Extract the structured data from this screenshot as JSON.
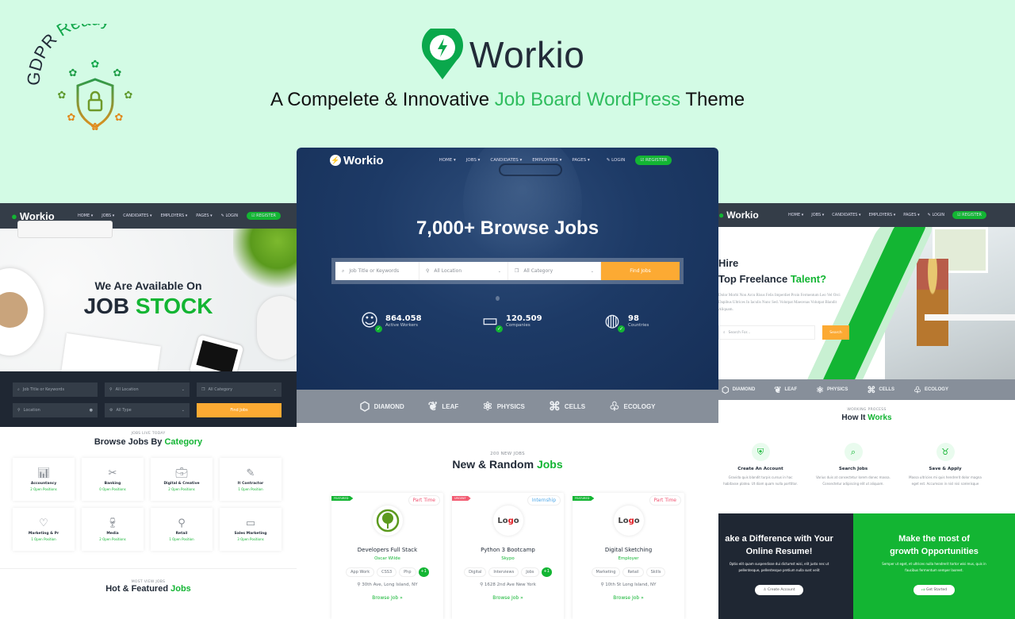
{
  "banner": {
    "gdpr_text_1": "GDPR",
    "gdpr_text_2": "Ready",
    "brand_name": "Workio",
    "tagline_pre": "A Compelete & Innovative ",
    "tagline_highlight": "Job Board WordPress",
    "tagline_post": " Theme"
  },
  "colors": {
    "brand_green": "#13b533",
    "accent_orange": "#fcaa33",
    "dark_navy": "#222b38",
    "banner_bg": "#d3fbe5"
  },
  "nav": {
    "logo": "Workio",
    "items": [
      "HOME",
      "JOBS",
      "CANDIDATES",
      "EMPLOYERS",
      "PAGES"
    ],
    "login": "LOGIN",
    "register": "REGISTER"
  },
  "left_screen": {
    "hero_subtitle": "We Are Available On",
    "hero_title_1": "JOB",
    "hero_title_2": "STOCK",
    "search": {
      "keywords_placeholder": "Job Title or Keywords",
      "location_select": "All Location",
      "category_select": "All Category",
      "location_placeholder": "Location",
      "type_select": "All Type",
      "button": "Find Jobs"
    },
    "categories_kicker": "JOBS LIVE TODAY",
    "categories_title_1": "Browse Jobs By",
    "categories_title_2": "Category",
    "categories": [
      {
        "name": "Accountancy",
        "count": "2 Open Positions",
        "icon": "chart-icon"
      },
      {
        "name": "Banking",
        "count": "0 Open Positions",
        "icon": "tools-icon"
      },
      {
        "name": "Digital & Creative",
        "count": "2 Open Positions",
        "icon": "briefcase-icon"
      },
      {
        "name": "It Contractor",
        "count": "1 Open Position",
        "icon": "edit-icon"
      },
      {
        "name": "Marketing & Pr",
        "count": "1 Open Position",
        "icon": "heart-icon"
      },
      {
        "name": "Media",
        "count": "2 Open Positions",
        "icon": "glass-icon"
      },
      {
        "name": "Retail",
        "count": "1 Open Position",
        "icon": "map-icon"
      },
      {
        "name": "Sales Marketing",
        "count": "3 Open Positions",
        "icon": "monitor-icon"
      }
    ],
    "hot_kicker": "MOST VIEW JOBS",
    "hot_title_1": "Hot & Featured",
    "hot_title_2": "Jobs"
  },
  "center_screen": {
    "hero_title": "7,000+ Browse Jobs",
    "search": {
      "keywords_placeholder": "Job Title or Keywords",
      "location_select": "All Location",
      "category_select": "All Category",
      "button": "Find Jobs"
    },
    "stats": [
      {
        "value": "864.058",
        "label": "Active Workers",
        "icon": "user-icon"
      },
      {
        "value": "120.509",
        "label": "Companies",
        "icon": "monitor-icon"
      },
      {
        "value": "98",
        "label": "Countries",
        "icon": "globe-icon"
      }
    ],
    "partners": [
      "DIAMOND",
      "LEAF",
      "PHYSICS",
      "CELLS",
      "ECOLOGY"
    ],
    "jobs_kicker": "200 NEW JOBS",
    "jobs_title_1": "New & Random",
    "jobs_title_2": "Jobs",
    "jobs": [
      {
        "badge": "FEATURED",
        "type": "Part Time",
        "title": "Developers Full Stack",
        "company": "Oscar Wilde",
        "tags": [
          "App Work",
          "CSS3",
          "Php"
        ],
        "more": "+1",
        "location": "30th Ave, Long Island, NY",
        "link": "Browse Job »"
      },
      {
        "badge": "URGENT",
        "type": "Internship",
        "title": "Python 3 Bootcamp",
        "company": "Skypo",
        "tags": [
          "Digital",
          "Interviews",
          "Jobs"
        ],
        "more": "+1",
        "location": "1628 2nd Ave New York",
        "link": "Browse Job »"
      },
      {
        "badge": "FEATURED",
        "type": "Part Time",
        "title": "Digital Sketching",
        "company": "Employer",
        "tags": [
          "Marketing",
          "Retail",
          "Skills"
        ],
        "more": "",
        "location": "10th St Long Island, NY",
        "link": "Browse Job »"
      }
    ]
  },
  "right_screen": {
    "hero_line_1": "Hire",
    "hero_line_2a": "Top Freelance",
    "hero_line_2b": "Talent?",
    "hero_text": "Dolor Morbi Non Arcu Risus Felis Imperdiet Proin Fermentum Leo Vel Orci Dapibus Ultrices In Iaculis Nunc Sed. Volutpat Maecenas Volutpat Blandit Aliquam.",
    "search_placeholder": "Search For...",
    "search_button": "Search",
    "partners": [
      "DIAMOND",
      "LEAF",
      "PHYSICS",
      "CELLS",
      "ECOLOGY"
    ],
    "how_kicker": "WORKING PROCESS",
    "how_title_1": "How It",
    "how_title_2": "Works",
    "steps": [
      {
        "title": "Create An Account",
        "text": "Gravida quis blandit turpis cursus in hac habitasse platea. Ut diam quam nulla porttitor."
      },
      {
        "title": "Search Jobs",
        "text": "Varius duis at consectetur lorem donec massa. Consectetur adipiscing elit ut aliquam."
      },
      {
        "title": "Save & Apply",
        "text": "Massa ultricies mi quis hendrerit dolor magna eget est. Accumsan in nisl nisi scelerisque"
      }
    ],
    "cta_left": {
      "title_1": "ake a Difference with Your",
      "title_2": "Online Resume!",
      "text": "Optio elit quam suspendisse dui dictumst wisi, elit justo nec ut pellentesque, pellentesque pretium nulla sunt velit",
      "button": "Create Account"
    },
    "cta_right": {
      "title_1": "Make the most of",
      "title_2": "growth Opportunities",
      "text": "Semper ut eget, et ultrices nulla hendrerit tortor wisi mus, quis in faucibus fermentum semper laoreet.",
      "button": "Get Started"
    }
  }
}
